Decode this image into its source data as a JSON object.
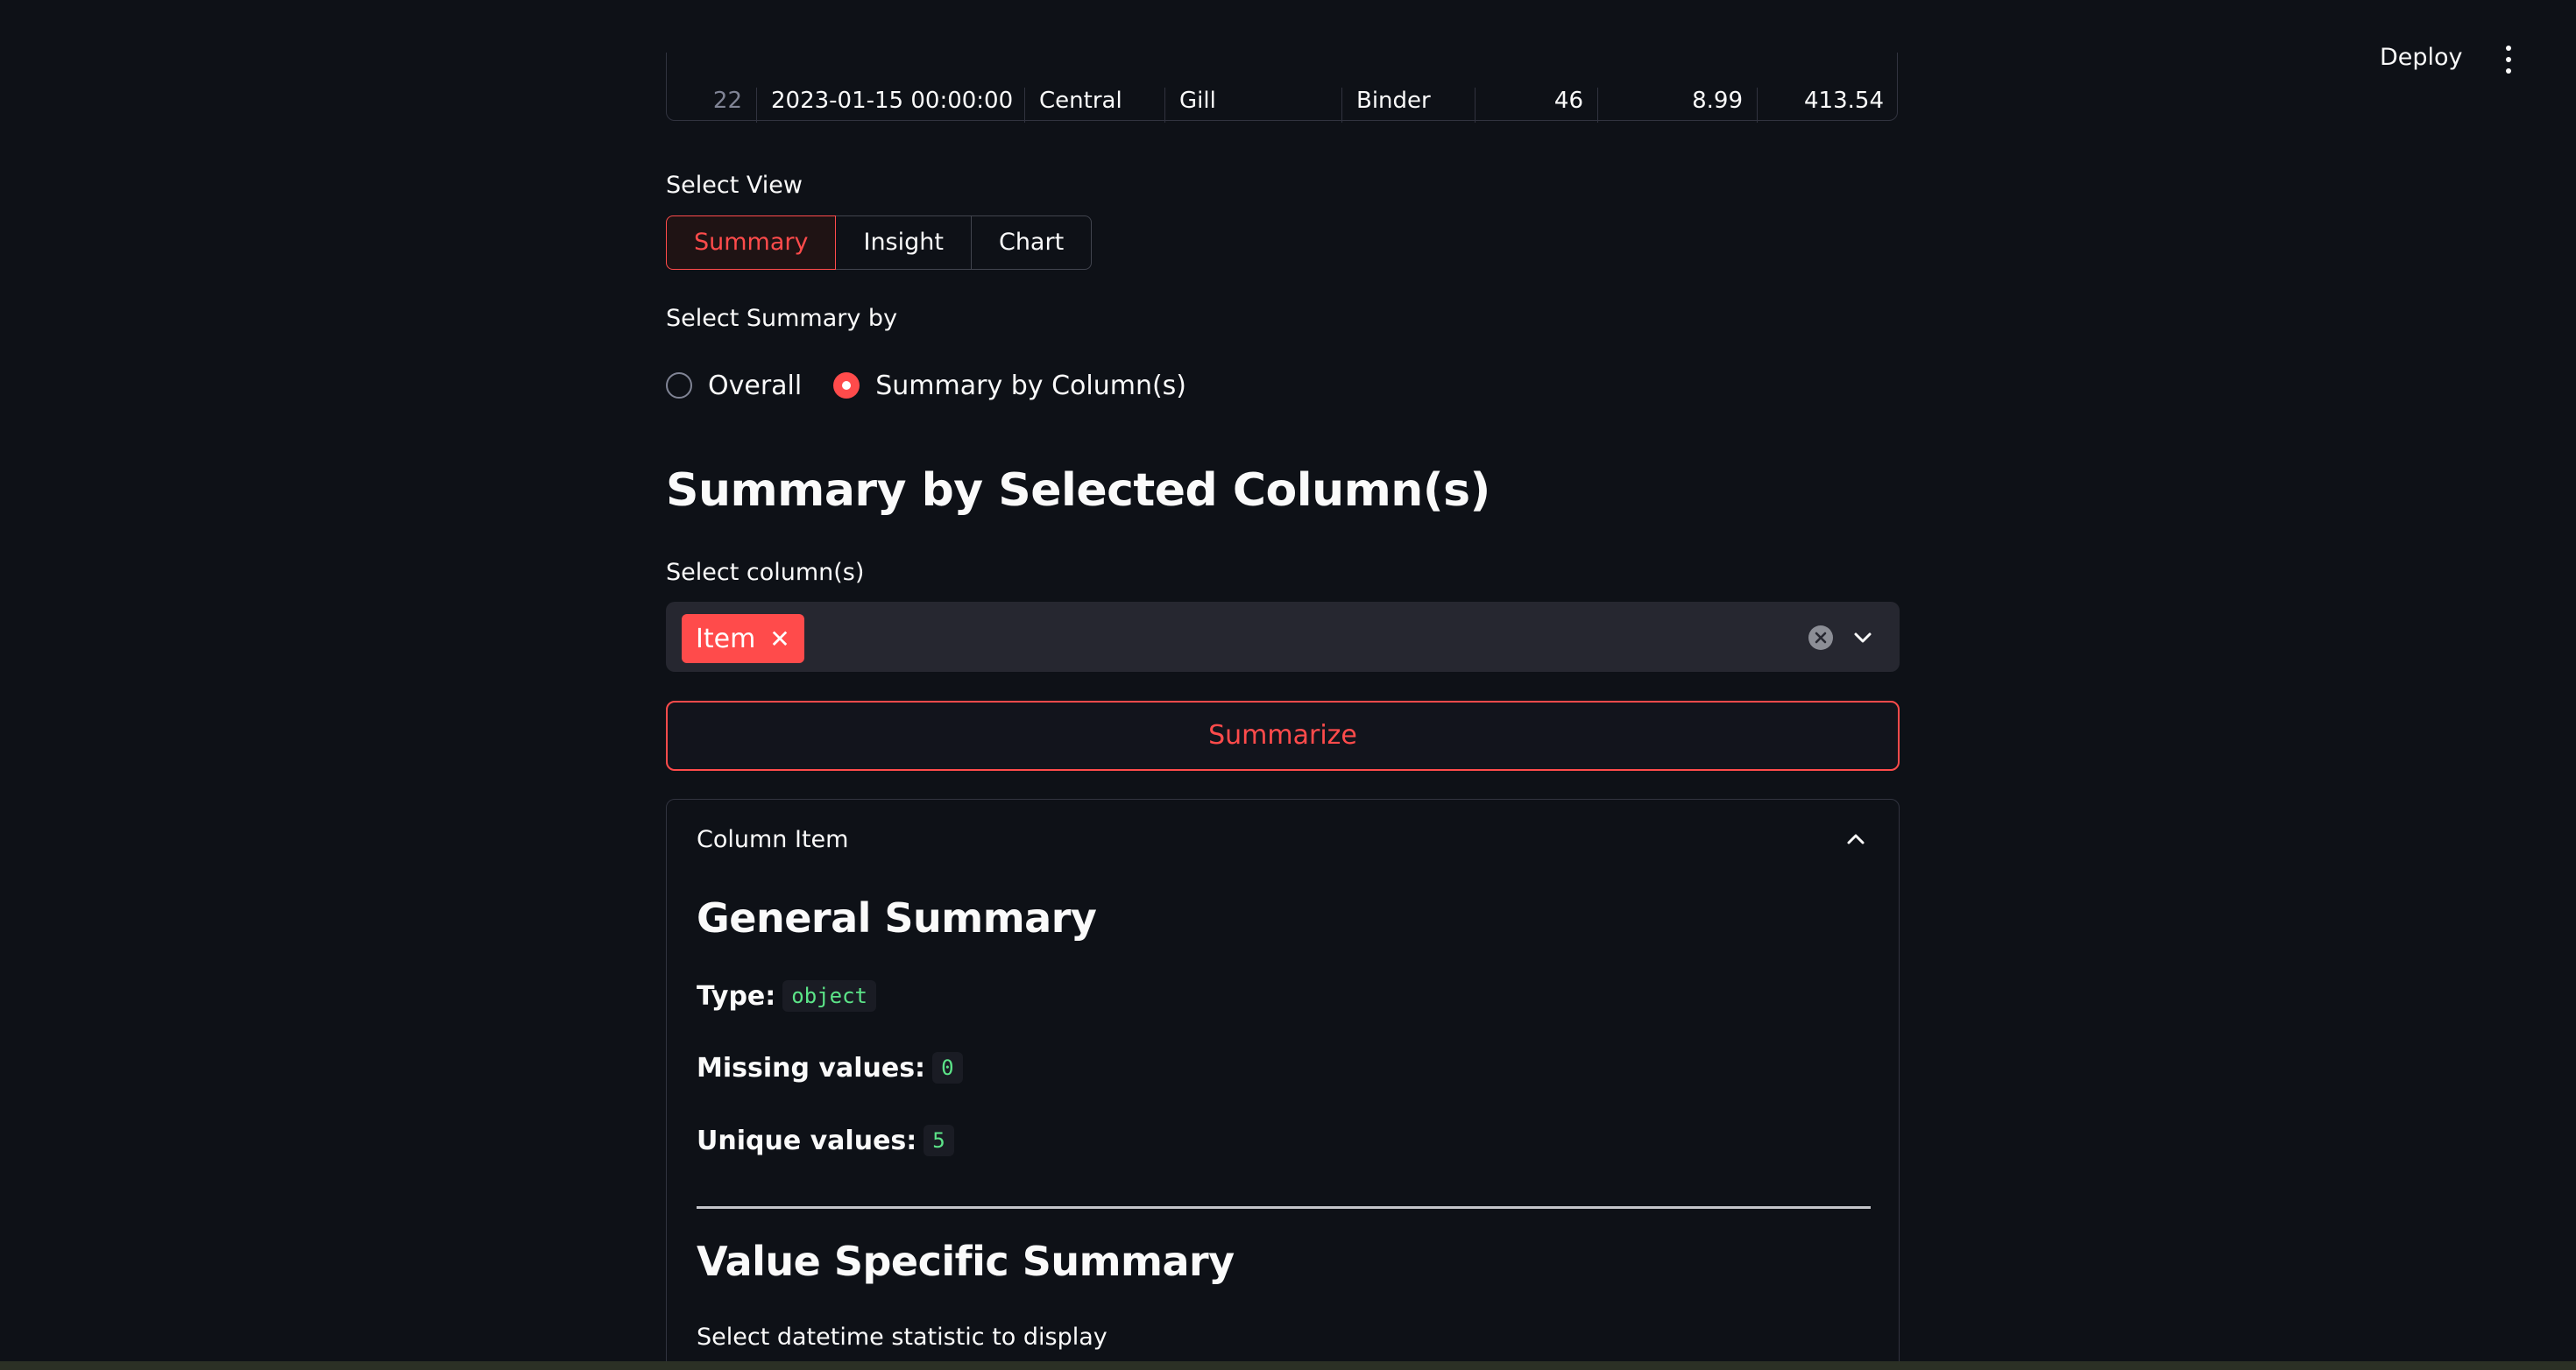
{
  "topbar": {
    "deploy_label": "Deploy",
    "menu_icon": "more-vertical-icon"
  },
  "dataframe_partial_row": [
    "22",
    "2023-01-15 00:00:00",
    "Central",
    "Gill",
    "Binder",
    "46",
    "8.99",
    "413.54"
  ],
  "view_selector": {
    "label": "Select View",
    "options": [
      "Summary",
      "Insight",
      "Chart"
    ],
    "selected": "Summary"
  },
  "summary_by": {
    "label": "Select Summary by",
    "options": [
      "Overall",
      "Summary by Column(s)"
    ],
    "selected": "Summary by Column(s)"
  },
  "main_heading": "Summary by Selected Column(s)",
  "columns_select": {
    "label": "Select column(s)",
    "selected_chips": [
      "Item"
    ],
    "chip_remove_glyph": "✕"
  },
  "summarize_button": "Summarize",
  "expander": {
    "title": "Column Item",
    "general_heading": "General Summary",
    "type_label": "Type:",
    "type_value": "object",
    "missing_label": "Missing values:",
    "missing_value": "0",
    "unique_label": "Unique values:",
    "unique_value": "5",
    "value_heading": "Value Specific Summary",
    "datetime_prompt": "Select datetime statistic to display"
  },
  "colors": {
    "background": "#0e1117",
    "accent": "#ff4b4b",
    "code_text": "#5ce488",
    "input_bg": "#262730"
  }
}
